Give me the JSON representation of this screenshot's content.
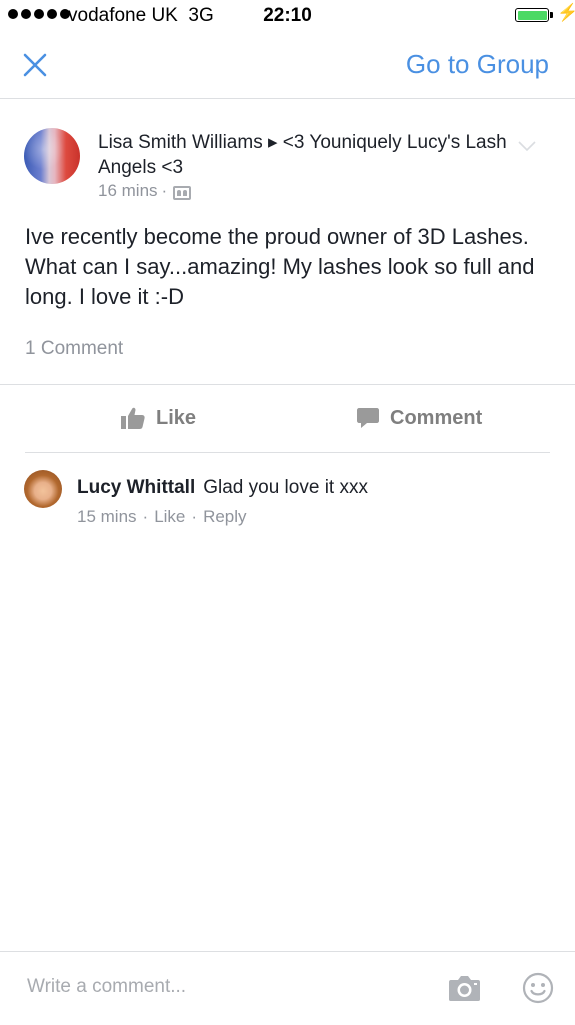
{
  "status_bar": {
    "carrier": "vodafone UK",
    "network": "3G",
    "time": "22:10",
    "signal_bars": 5,
    "battery_color": "#4cd964"
  },
  "nav": {
    "close_icon": "close-icon",
    "go_to_group": "Go to Group",
    "accent_color": "#4a90e2"
  },
  "post": {
    "author_line": "Lisa Smith Williams ▸ <3  Youniquely Lucy's Lash Angels <3",
    "time": "16 mins",
    "dot": "·",
    "audience_icon": "group-icon",
    "text": "Ive recently become the proud owner of 3D Lashes. What can I say...amazing! My lashes look so full and long. I love it :-D",
    "comment_count": "1 Comment"
  },
  "actions": {
    "like": "Like",
    "comment": "Comment"
  },
  "comment": {
    "name": "Lucy Whittall",
    "text": "Glad you love it xxx",
    "time": "15 mins",
    "sep": "·",
    "like": "Like",
    "reply": "Reply"
  },
  "composer": {
    "placeholder": "Write a comment...",
    "camera_icon": "camera-icon",
    "emoji_icon": "smiley-icon"
  }
}
